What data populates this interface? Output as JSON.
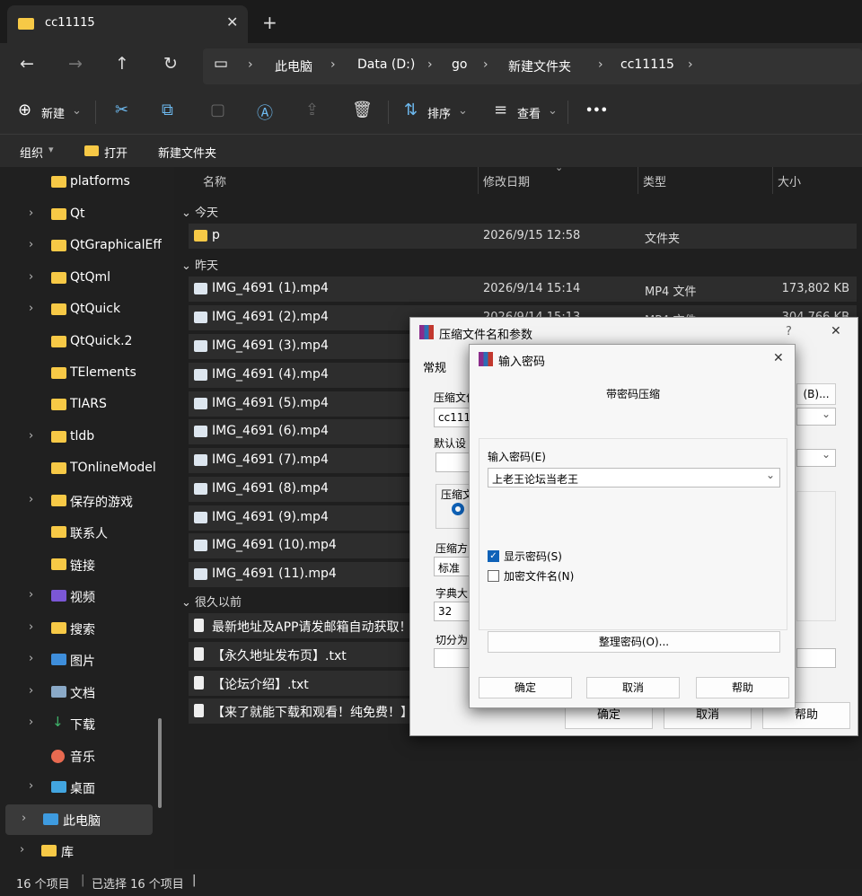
{
  "tab": {
    "title": "cc11115",
    "close": "✕",
    "new": "+"
  },
  "nav": {
    "back": "←",
    "forward": "→",
    "up": "↑",
    "refresh": "↻",
    "monitor": "▭"
  },
  "breadcrumb": [
    "此电脑",
    "Data (D:)",
    "go",
    "新建文件夹",
    "cc11115"
  ],
  "toolbar": {
    "new_label": "新建",
    "sort_label": "排序",
    "view_label": "查看",
    "more": "•••"
  },
  "cmdbar": {
    "organize": "组织",
    "open": "打开",
    "new_folder": "新建文件夹"
  },
  "sidebar": [
    {
      "label": "platforms",
      "chevron": false,
      "icon": "folder"
    },
    {
      "label": "Qt",
      "chevron": true,
      "icon": "folder"
    },
    {
      "label": "QtGraphicalEff",
      "chevron": true,
      "icon": "folder"
    },
    {
      "label": "QtQml",
      "chevron": true,
      "icon": "folder"
    },
    {
      "label": "QtQuick",
      "chevron": true,
      "icon": "folder"
    },
    {
      "label": "QtQuick.2",
      "chevron": false,
      "icon": "folder"
    },
    {
      "label": "TElements",
      "chevron": false,
      "icon": "folder"
    },
    {
      "label": "TIARS",
      "chevron": false,
      "icon": "folder"
    },
    {
      "label": "tldb",
      "chevron": true,
      "icon": "folder"
    },
    {
      "label": "TOnlineModel",
      "chevron": false,
      "icon": "folder"
    },
    {
      "label": "保存的游戏",
      "chevron": true,
      "icon": "folder"
    },
    {
      "label": "联系人",
      "chevron": false,
      "icon": "folder"
    },
    {
      "label": "链接",
      "chevron": false,
      "icon": "folder"
    },
    {
      "label": "视频",
      "chevron": true,
      "icon": "video"
    },
    {
      "label": "搜索",
      "chevron": true,
      "icon": "folder"
    },
    {
      "label": "图片",
      "chevron": true,
      "icon": "picture"
    },
    {
      "label": "文档",
      "chevron": true,
      "icon": "document"
    },
    {
      "label": "下载",
      "chevron": true,
      "icon": "download"
    },
    {
      "label": "音乐",
      "chevron": false,
      "icon": "music"
    },
    {
      "label": "桌面",
      "chevron": true,
      "icon": "desktop"
    },
    {
      "label": "此电脑",
      "chevron": true,
      "icon": "computer"
    },
    {
      "label": "库",
      "chevron": true,
      "icon": "folder"
    }
  ],
  "columns": {
    "name": "名称",
    "date": "修改日期",
    "type": "类型",
    "size": "大小"
  },
  "groups": {
    "today": "今天",
    "yesterday": "昨天",
    "long_ago": "很久以前"
  },
  "files_today": [
    {
      "name": "p",
      "date": "2026/9/15 12:58",
      "type": "文件夹",
      "size": ""
    }
  ],
  "files_yesterday": [
    {
      "name": "IMG_4691 (1).mp4",
      "date": "2026/9/14 15:14",
      "type": "MP4 文件",
      "size": "173,802 KB"
    },
    {
      "name": "IMG_4691 (2).mp4",
      "date": "2026/9/14 15:13",
      "type": "MP4 文件",
      "size": "304,766 KB"
    },
    {
      "name": "IMG_4691 (3).mp4"
    },
    {
      "name": "IMG_4691 (4).mp4"
    },
    {
      "name": "IMG_4691 (5).mp4"
    },
    {
      "name": "IMG_4691 (6).mp4"
    },
    {
      "name": "IMG_4691 (7).mp4"
    },
    {
      "name": "IMG_4691 (8).mp4"
    },
    {
      "name": "IMG_4691 (9).mp4"
    },
    {
      "name": "IMG_4691 (10).mp4"
    },
    {
      "name": "IMG_4691 (11).mp4"
    }
  ],
  "files_old": [
    {
      "name": "最新地址及APP请发邮箱自动获取！！"
    },
    {
      "name": "【永久地址发布页】.txt"
    },
    {
      "name": "【论坛介绍】.txt"
    },
    {
      "name": "【来了就能下载和观看！纯免费！】.t"
    }
  ],
  "status": {
    "count": "16 个项目",
    "selected": "已选择 16 个项目"
  },
  "archive_dialog": {
    "title": "压缩文件名和参数",
    "help": "?",
    "close": "✕",
    "tab_general": "常规",
    "label_filename": "压缩文件",
    "filename_value": "cc1111",
    "browse": "(B)...",
    "label_default": "默认设",
    "label_format": "压缩文",
    "label_method": "压缩方",
    "method_value": "标准",
    "label_dict": "字典大",
    "dict_value": "32",
    "label_split": "切分为",
    "ok": "确定",
    "cancel": "取消",
    "help_btn": "帮助"
  },
  "password_dialog": {
    "title": "输入密码",
    "close": "✕",
    "heading": "带密码压缩",
    "label_password": "输入密码(E)",
    "password_value": "上老王论坛当老王",
    "show_password": "显示密码(S)",
    "encrypt_names": "加密文件名(N)",
    "organize": "整理密码(O)...",
    "ok": "确定",
    "cancel": "取消",
    "help": "帮助"
  }
}
